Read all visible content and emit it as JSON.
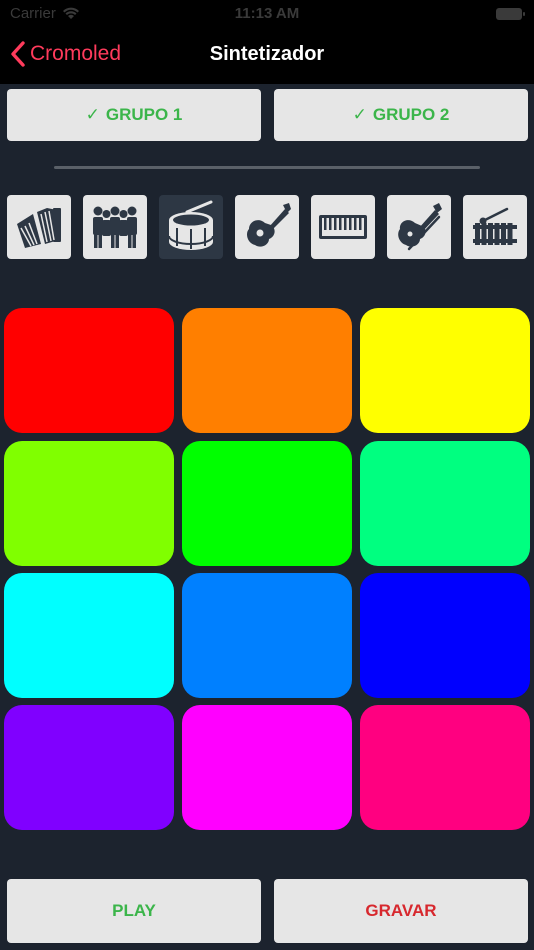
{
  "status": {
    "carrier": "Carrier",
    "time": "11:13 AM"
  },
  "nav": {
    "back_label": "Cromoled",
    "title": "Sintetizador",
    "accent": "#ff3b5c"
  },
  "groups": [
    {
      "label": "GRUPO 1",
      "check": "✓"
    },
    {
      "label": "GRUPO 2",
      "check": "✓"
    }
  ],
  "instruments": [
    {
      "icon": "accordion-icon",
      "selected": false
    },
    {
      "icon": "choir-icon",
      "selected": false
    },
    {
      "icon": "drum-icon",
      "selected": true
    },
    {
      "icon": "acoustic-guitar-icon",
      "selected": false
    },
    {
      "icon": "keyboard-icon",
      "selected": false
    },
    {
      "icon": "violin-icon",
      "selected": false
    },
    {
      "icon": "xylophone-icon",
      "selected": false
    }
  ],
  "pads": [
    "#ff0000",
    "#ff7f00",
    "#ffff00",
    "#80ff00",
    "#00ff00",
    "#00ff80",
    "#00ffff",
    "#0080ff",
    "#0000ff",
    "#8000ff",
    "#ff00ff",
    "#ff0080"
  ],
  "actions": {
    "play": {
      "label": "PLAY",
      "color": "#3bb54a"
    },
    "record": {
      "label": "GRAVAR",
      "color": "#d7282e"
    }
  }
}
